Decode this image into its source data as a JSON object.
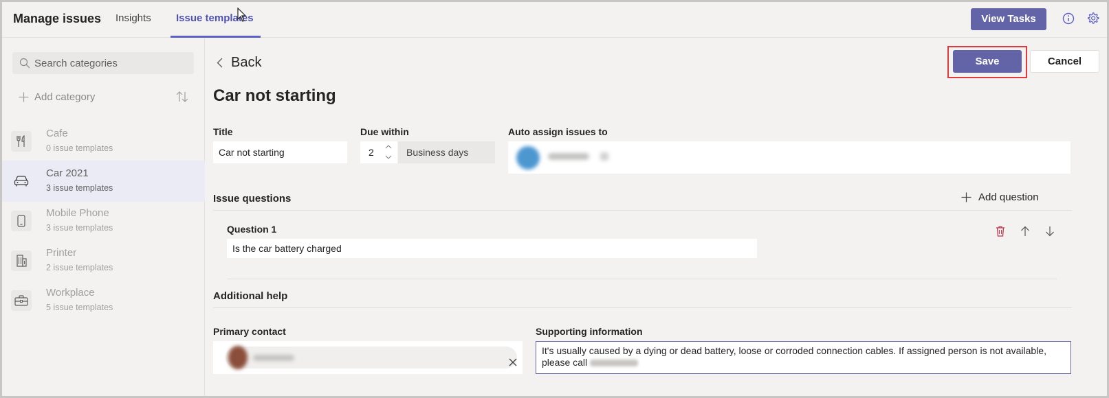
{
  "header": {
    "app_title": "Manage issues",
    "tabs": [
      {
        "label": "Insights"
      },
      {
        "label": "Issue templates"
      }
    ],
    "view_tasks_label": "View Tasks"
  },
  "sidebar": {
    "search_placeholder": "Search categories",
    "add_category_label": "Add category",
    "categories": [
      {
        "name": "Cafe",
        "count": "0 issue templates",
        "icon": "fork-knife-icon"
      },
      {
        "name": "Car 2021",
        "count": "3 issue templates",
        "icon": "car-icon"
      },
      {
        "name": "Mobile Phone",
        "count": "3 issue templates",
        "icon": "phone-icon"
      },
      {
        "name": "Printer",
        "count": "2 issue templates",
        "icon": "building-icon"
      },
      {
        "name": "Workplace",
        "count": "5 issue templates",
        "icon": "briefcase-icon"
      }
    ]
  },
  "main": {
    "back_label": "Back",
    "save_label": "Save",
    "cancel_label": "Cancel",
    "page_title": "Car not starting",
    "title_label": "Title",
    "title_value": "Car not starting",
    "due_label": "Due within",
    "due_value": "2",
    "due_unit": "Business days",
    "assign_label": "Auto assign issues to",
    "issue_questions_label": "Issue questions",
    "add_question_label": "Add question",
    "question_label": "Question 1",
    "question_value": "Is the car battery charged",
    "additional_help_label": "Additional help",
    "primary_contact_label": "Primary contact",
    "supporting_info_label": "Supporting information",
    "supporting_info_text": "It's usually caused by a dying or dead battery, loose or corroded connection cables. If assigned person is not available, please call"
  },
  "colors": {
    "accent": "#6264a7",
    "tab_active": "#4f52b2",
    "highlight_border": "#e03a3e",
    "delete_icon": "#c4314b"
  }
}
